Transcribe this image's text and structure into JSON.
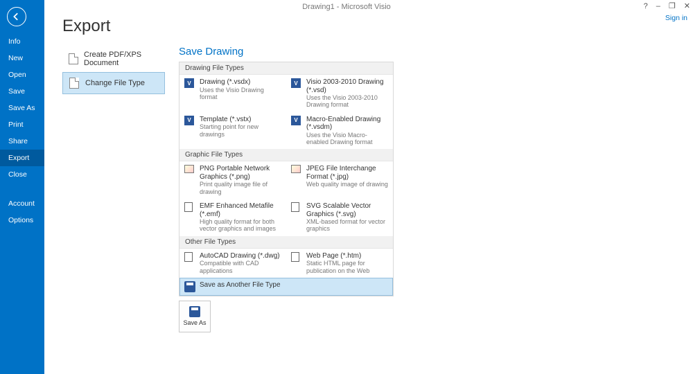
{
  "titlebar": {
    "title": "Drawing1 - Microsoft Visio"
  },
  "window": {
    "help": "?",
    "min": "–",
    "restore": "❐",
    "close": "✕",
    "signin": "Sign in"
  },
  "sidebar": {
    "items": [
      {
        "label": "Info"
      },
      {
        "label": "New"
      },
      {
        "label": "Open"
      },
      {
        "label": "Save"
      },
      {
        "label": "Save As"
      },
      {
        "label": "Print"
      },
      {
        "label": "Share"
      },
      {
        "label": "Export",
        "selected": true
      },
      {
        "label": "Close"
      }
    ],
    "bottom": [
      {
        "label": "Account"
      },
      {
        "label": "Options"
      }
    ]
  },
  "main": {
    "title": "Export",
    "left_options": [
      {
        "label": "Create PDF/XPS Document"
      },
      {
        "label": "Change File Type",
        "selected": true
      }
    ],
    "right": {
      "section_title": "Save Drawing",
      "groups": [
        {
          "header": "Drawing File Types",
          "items": [
            {
              "name": "Drawing (*.vsdx)",
              "desc": "Uses the Visio Drawing format",
              "icon": "visio"
            },
            {
              "name": "Visio 2003-2010 Drawing (*.vsd)",
              "desc": "Uses the Visio 2003-2010 Drawing format",
              "icon": "visio"
            },
            {
              "name": "Template (*.vstx)",
              "desc": "Starting point for new drawings",
              "icon": "visio"
            },
            {
              "name": "Macro-Enabled Drawing (*.vsdm)",
              "desc": "Uses the Visio Macro-enabled Drawing format",
              "icon": "visio"
            }
          ]
        },
        {
          "header": "Graphic File Types",
          "items": [
            {
              "name": "PNG Portable Network Graphics (*.png)",
              "desc": "Print quality image file of drawing",
              "icon": "img"
            },
            {
              "name": "JPEG File Interchange Format (*.jpg)",
              "desc": "Web quality image of drawing",
              "icon": "img"
            },
            {
              "name": "EMF Enhanced Metafile (*.emf)",
              "desc": "High quality format for both vector graphics and images",
              "icon": "page"
            },
            {
              "name": "SVG Scalable Vector Graphics (*.svg)",
              "desc": "XML-based format for vector graphics",
              "icon": "page"
            }
          ]
        },
        {
          "header": "Other File Types",
          "items": [
            {
              "name": "AutoCAD Drawing (*.dwg)",
              "desc": "Compatible with CAD applications",
              "icon": "page"
            },
            {
              "name": "Web Page (*.htm)",
              "desc": "Static HTML page for publication on the Web",
              "icon": "page"
            },
            {
              "name": "Save as Another File Type",
              "desc": "",
              "icon": "save",
              "selected": true,
              "span": 2
            }
          ]
        }
      ],
      "saveas_button": "Save As"
    }
  }
}
